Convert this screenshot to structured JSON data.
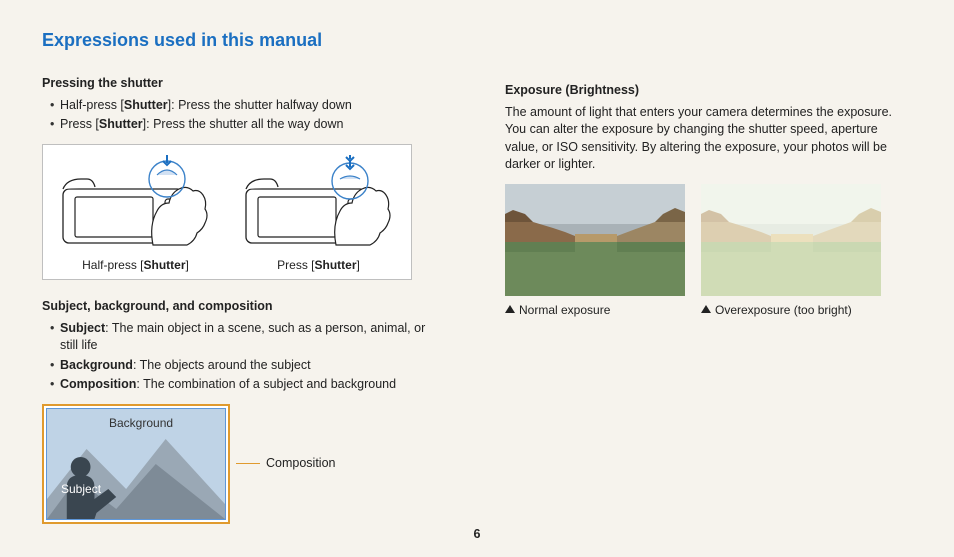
{
  "title": "Expressions used in this manual",
  "page_number": "6",
  "left": {
    "shutter": {
      "heading": "Pressing the shutter",
      "items": [
        {
          "prefix": "Half-press [",
          "bold": "Shutter",
          "suffix": "]: Press the shutter halfway down"
        },
        {
          "prefix": "Press [",
          "bold": "Shutter",
          "suffix": "]: Press the shutter all the way down"
        }
      ],
      "captions": [
        {
          "prefix": "Half-press [",
          "bold": "Shutter",
          "suffix": "]"
        },
        {
          "prefix": "Press [",
          "bold": "Shutter",
          "suffix": "]"
        }
      ]
    },
    "subject": {
      "heading": "Subject, background, and composition",
      "items": [
        {
          "bold": "Subject",
          "text": ": The main object in a scene, such as a person, animal, or still life"
        },
        {
          "bold": "Background",
          "text": ": The objects around the subject"
        },
        {
          "bold": "Composition",
          "text": ": The combination of a subject and background"
        }
      ],
      "labels": {
        "background": "Background",
        "subject": "Subject",
        "composition": "Composition"
      }
    }
  },
  "right": {
    "exposure": {
      "heading": "Exposure (Brightness)",
      "paragraph": "The amount of light that enters your camera determines the exposure. You can alter the exposure by changing the shutter speed, aperture value, or ISO sensitivity. By altering the exposure, your photos will be darker or lighter.",
      "captions": {
        "normal": "Normal exposure",
        "over": "Overexposure (too bright)"
      }
    }
  }
}
